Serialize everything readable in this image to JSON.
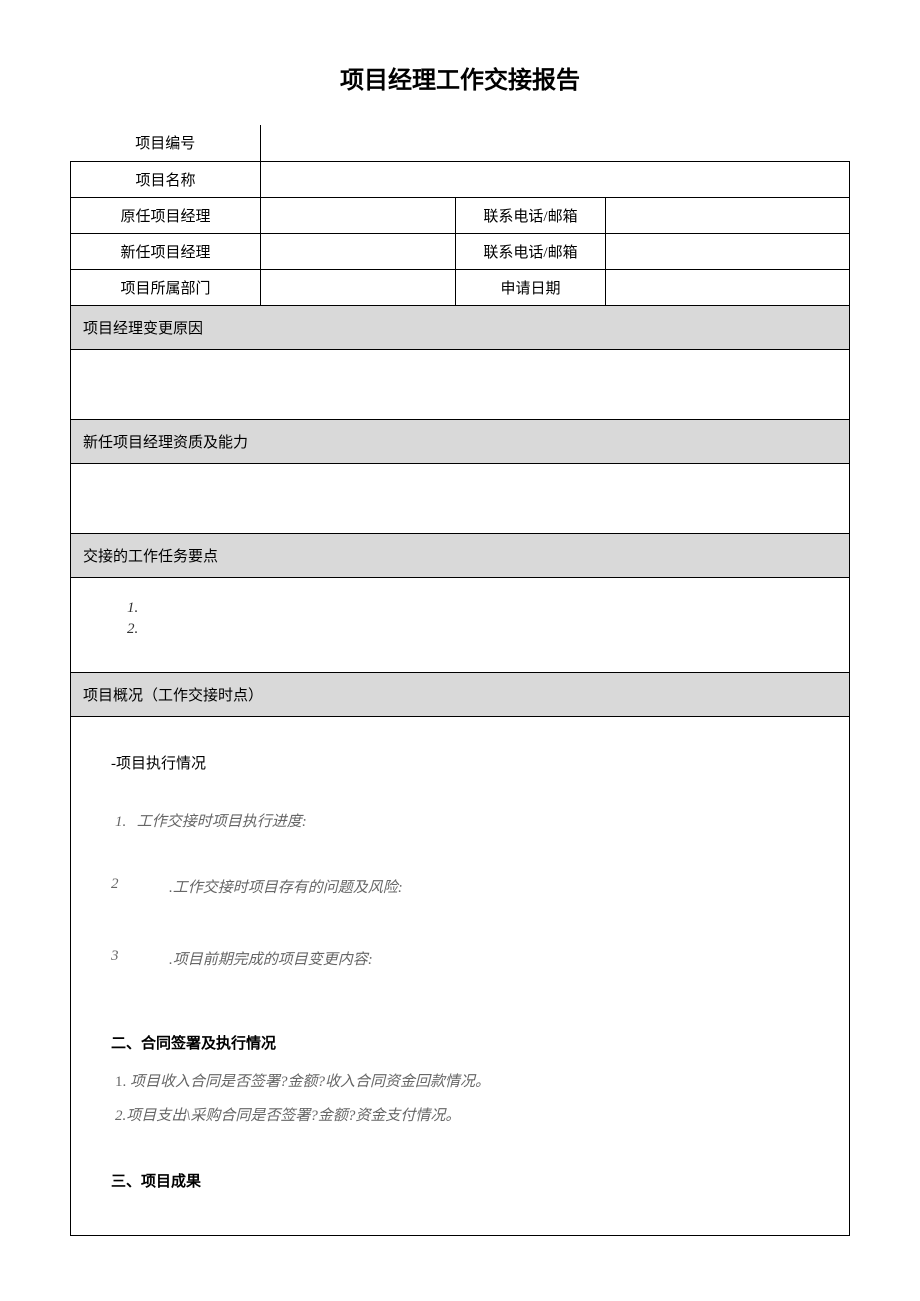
{
  "title": "项目经理工作交接报告",
  "header_rows": {
    "project_no_label": "项目编号",
    "project_name_label": "项目名称",
    "prev_pm_label": "原任项目经理",
    "prev_pm_contact_label": "联系电话/邮箱",
    "new_pm_label": "新任项目经理",
    "new_pm_contact_label": "联系电话/邮箱",
    "dept_label": "项目所属部门",
    "apply_date_label": "申请日期"
  },
  "sections": {
    "change_reason": "项目经理变更原因",
    "new_pm_qualification": "新任项目经理资质及能力",
    "handover_points": "交接的工作任务要点",
    "project_overview": "项目概况（工作交接时点）"
  },
  "handover_list": {
    "item1": "1.",
    "item2": "2."
  },
  "overview": {
    "sec1_title": "-项目执行情况",
    "sec1_item1_num": "1.",
    "sec1_item1_text": "工作交接时项目执行进度:",
    "sec1_item2_num": "2",
    "sec1_item2_text": ".工作交接时项目存有的问题及风险:",
    "sec1_item3_num": "3",
    "sec1_item3_text": ".项目前期完成的项目变更内容:",
    "sec2_title": "二、合同签署及执行情况",
    "sec2_item1_num": "1.",
    "sec2_item1_text": "项目收入合同是否签署?金额?收入合同资金回款情况。",
    "sec2_item2": "2.项目支出\\采购合同是否签署?金额?资金支付情况。",
    "sec3_title": "三、项目成果"
  }
}
